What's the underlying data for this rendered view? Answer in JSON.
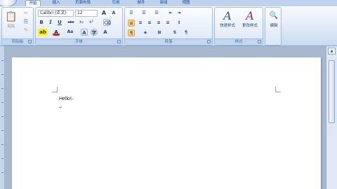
{
  "tabs": [
    "开始",
    "插入",
    "页面布局",
    "引用",
    "邮件",
    "审阅",
    "视图"
  ],
  "clipboard": {
    "label": "剪贴板",
    "paste": "粘贴"
  },
  "font": {
    "label": "字体",
    "name": "Calibri (正文)",
    "size": "12",
    "grow": "A",
    "shrink": "A",
    "bold": "B",
    "italic": "I",
    "underline": "U",
    "strike": "abc",
    "sub": "x₂",
    "sup": "x²",
    "font_color": "A",
    "case": "Aa"
  },
  "paragraph": {
    "label": "段落"
  },
  "styles": {
    "label": "样式",
    "quick_styles": "快速样式",
    "change_styles": "更改样式"
  },
  "editing": {
    "label": "编辑"
  },
  "document": {
    "text": "Hello!"
  }
}
